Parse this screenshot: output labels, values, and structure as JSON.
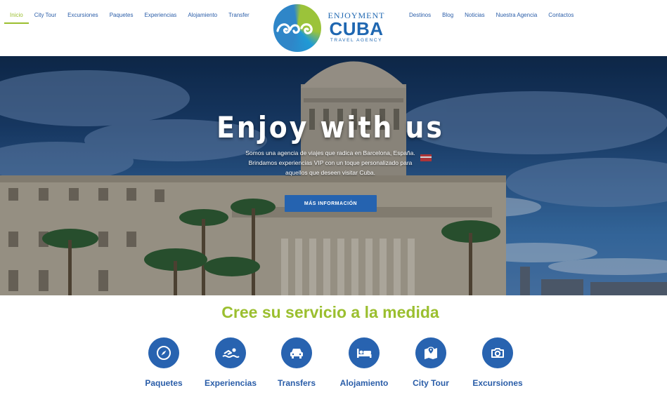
{
  "nav": {
    "left": [
      {
        "label": "Inicio",
        "active": true
      },
      {
        "label": "City Tour"
      },
      {
        "label": "Excursiones"
      },
      {
        "label": "Paquetes"
      },
      {
        "label": "Experiencias"
      },
      {
        "label": "Alojamiento"
      },
      {
        "label": "Transfer"
      }
    ],
    "right": [
      {
        "label": "Destinos"
      },
      {
        "label": "Blog"
      },
      {
        "label": "Noticias"
      },
      {
        "label": "Nuestra Agencia"
      },
      {
        "label": "Contactos"
      }
    ]
  },
  "logo": {
    "top": "ENJOYMENT",
    "main": "CUBA",
    "sub": "TRAVEL AGENCY"
  },
  "hero": {
    "title": "Enjoy with us",
    "description": "Somos una agencia de viajes que radica en Barcelona, España. Brindamos experiencias VIP con un toque personalizado para aquellos que deseen visitar Cuba.",
    "button": "MÁS INFORMACIÓN"
  },
  "services": {
    "title": "Cree su servicio a la medida",
    "items": [
      {
        "label": "Paquetes",
        "icon": "compass-icon"
      },
      {
        "label": "Experiencias",
        "icon": "swimmer-icon"
      },
      {
        "label": "Transfers",
        "icon": "car-icon"
      },
      {
        "label": "Alojamiento",
        "icon": "bed-icon"
      },
      {
        "label": "City Tour",
        "icon": "map-icon"
      },
      {
        "label": "Excursiones",
        "icon": "camera-icon"
      }
    ]
  },
  "colors": {
    "brand_blue": "#2863b0",
    "accent_green": "#9bbf2f"
  }
}
